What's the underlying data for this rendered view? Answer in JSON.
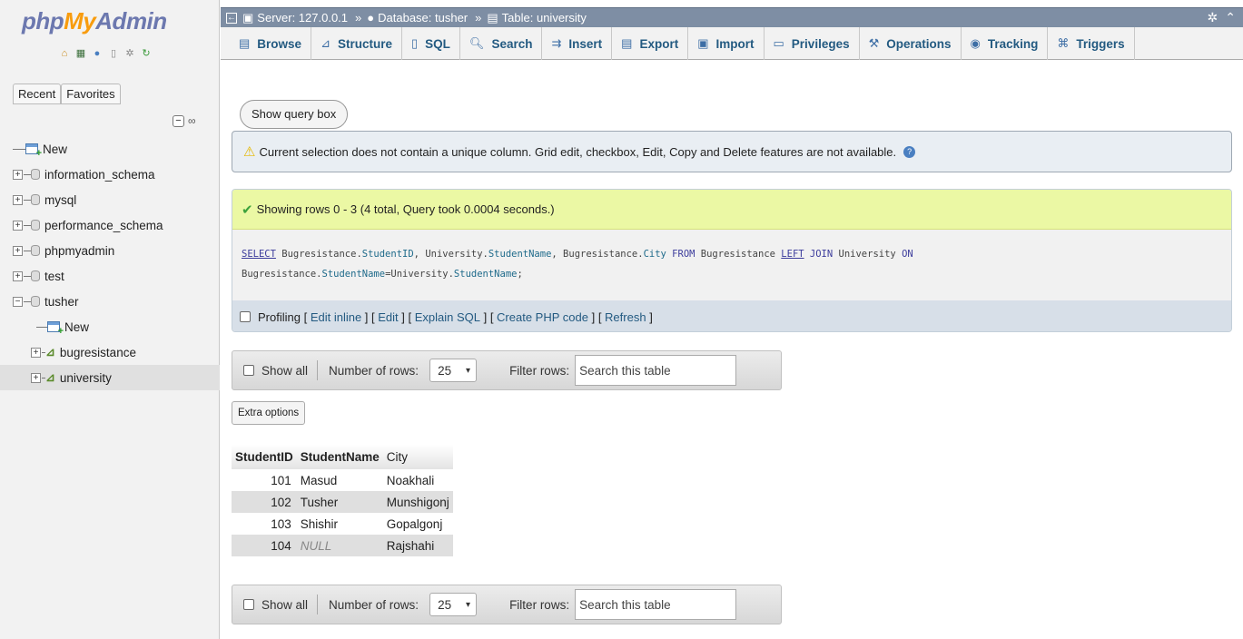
{
  "logo": {
    "php": "php",
    "my": "My",
    "admin": "Admin"
  },
  "sidebar": {
    "quick_icons": [
      "home-icon",
      "database-icon",
      "help-icon",
      "docs-icon",
      "settings-icon",
      "reload-icon"
    ],
    "tabs": [
      "Recent",
      "Favorites"
    ],
    "tree": [
      {
        "label": "New",
        "type": "new"
      },
      {
        "label": "information_schema",
        "type": "db"
      },
      {
        "label": "mysql",
        "type": "db"
      },
      {
        "label": "performance_schema",
        "type": "db"
      },
      {
        "label": "phpmyadmin",
        "type": "db"
      },
      {
        "label": "test",
        "type": "db"
      },
      {
        "label": "tusher",
        "type": "db-open"
      },
      {
        "label": "New",
        "type": "child-new"
      },
      {
        "label": "bugresistance",
        "type": "table"
      },
      {
        "label": "university",
        "type": "table-selected"
      }
    ]
  },
  "breadcrumb": {
    "server": "Server: 127.0.0.1",
    "database": "Database: tusher",
    "table": "Table: university",
    "separator": "»"
  },
  "menu": [
    "Browse",
    "Structure",
    "SQL",
    "Search",
    "Insert",
    "Export",
    "Import",
    "Privileges",
    "Operations",
    "Tracking",
    "Triggers"
  ],
  "main": {
    "show_query_box": "Show query box",
    "notice": "Current selection does not contain a unique column. Grid edit, checkbox, Edit, Copy and Delete features are not available.",
    "success": "Showing rows 0 - 3 (4 total, Query took 0.0004 seconds.)",
    "sql_line1": {
      "select": "SELECT",
      "p1": " Bugresistance.",
      "c1": "StudentID",
      "p2": ", University.",
      "c2": "StudentName",
      "p3": ", Bugresistance.",
      "c3": "City",
      "from": " FROM",
      "p4": " Bugresistance ",
      "left": "LEFT",
      "join": " JOIN",
      "p5": " University ",
      "on": "ON"
    },
    "sql_line2": {
      "p1": "Bugresistance.",
      "c1": "StudentName",
      "p2": "=University.",
      "c2": "StudentName",
      "p3": ";"
    },
    "profiling": {
      "label": "Profiling",
      "links": [
        "Edit inline",
        "Edit",
        "Explain SQL",
        "Create PHP code",
        "Refresh"
      ]
    },
    "nav": {
      "show_all": "Show all",
      "rows_label": "Number of rows:",
      "rows_value": "25",
      "filter_label": "Filter rows:",
      "filter_placeholder": "Search this table"
    },
    "extra_options": "Extra options",
    "table": {
      "columns": [
        "StudentID",
        "StudentName",
        "City"
      ],
      "rows": [
        [
          "101",
          "Masud",
          "Noakhali"
        ],
        [
          "102",
          "Tusher",
          "Munshigonj"
        ],
        [
          "103",
          "Shishir",
          "Gopalgonj"
        ],
        [
          "104",
          "NULL",
          "Rajshahi"
        ]
      ]
    }
  }
}
